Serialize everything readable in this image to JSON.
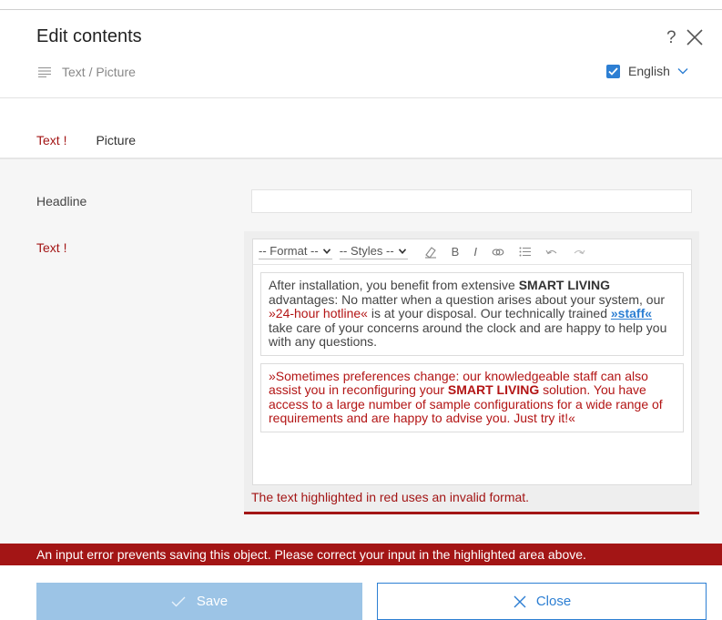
{
  "dialog": {
    "title": "Edit contents",
    "help_label": "?",
    "subtitle": "Text / Picture",
    "language": "English"
  },
  "tabs": [
    {
      "label": "Text",
      "marker": "!"
    },
    {
      "label": "Picture"
    }
  ],
  "form": {
    "headline_label": "Headline",
    "headline_value": "",
    "text_label": "Text",
    "text_marker": "!"
  },
  "editor": {
    "format_label": "-- Format --",
    "styles_label": "-- Styles --",
    "bold_label": "B",
    "italic_label": "I",
    "paragraph1": {
      "part1": "After installation, you benefit from extensive ",
      "bold1": "SMART LIVING",
      "part2": " advantages: No matter when a question arises about your system, our ",
      "red1": "»24-hour hotline«",
      "part3": " is at your disposal. Our technically trained ",
      "link1": "»staff«",
      "part4": " take care of your concerns around the clock and are happy to help you with any questions."
    },
    "paragraph2": {
      "part1": "»Sometimes preferences change: our knowledgeable staff can also assist you in reconfiguring your ",
      "bold1": "SMART LIVING",
      "part2": " solution. You have access to a large number of sample configurations for a wide range of requirements and are happy to advise you. Just try it!«"
    },
    "invalid_hint": "The text highlighted in red uses an invalid format."
  },
  "error_bar": "An input error prevents saving this object. Please correct your input in the highlighted area above.",
  "buttons": {
    "save": "Save",
    "close": "Close"
  },
  "colors": {
    "accent": "#2d7fd3",
    "error": "#a31515",
    "save_disabled": "#9cc4e6"
  }
}
